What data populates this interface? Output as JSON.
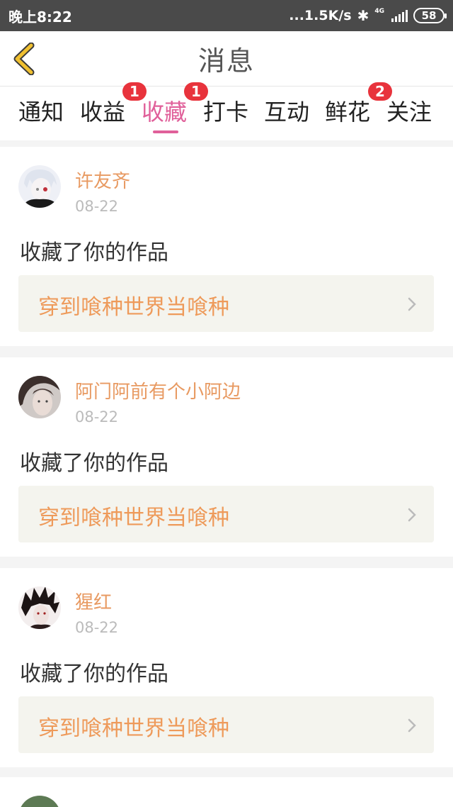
{
  "status_bar": {
    "time": "晚上8:22",
    "net_speed": "...1.5K/s",
    "network": "4G",
    "battery": "58"
  },
  "header": {
    "title": "消息",
    "back_icon": "chevron-left-icon"
  },
  "tabs": [
    {
      "label": "通知",
      "badge": ""
    },
    {
      "label": "收益",
      "badge": "1"
    },
    {
      "label": "收藏",
      "badge": "1",
      "active": true
    },
    {
      "label": "打卡",
      "badge": ""
    },
    {
      "label": "互动",
      "badge": ""
    },
    {
      "label": "鲜花",
      "badge": "2"
    },
    {
      "label": "关注",
      "badge": ""
    }
  ],
  "messages": [
    {
      "user": "许友齐",
      "date": "08-22",
      "action": "收藏了你的作品",
      "work": "穿到喰种世界当喰种"
    },
    {
      "user": "阿门阿前有个小阿边",
      "date": "08-22",
      "action": "收藏了你的作品",
      "work": "穿到喰种世界当喰种"
    },
    {
      "user": "猩红",
      "date": "08-22",
      "action": "收藏了你的作品",
      "work": "穿到喰种世界当喰种"
    }
  ],
  "colors": {
    "accent": "#e0609a",
    "username": "#e89a62",
    "work_title": "#ee9a5a",
    "badge": "#e8333c",
    "back_icon": "#f0c030"
  }
}
